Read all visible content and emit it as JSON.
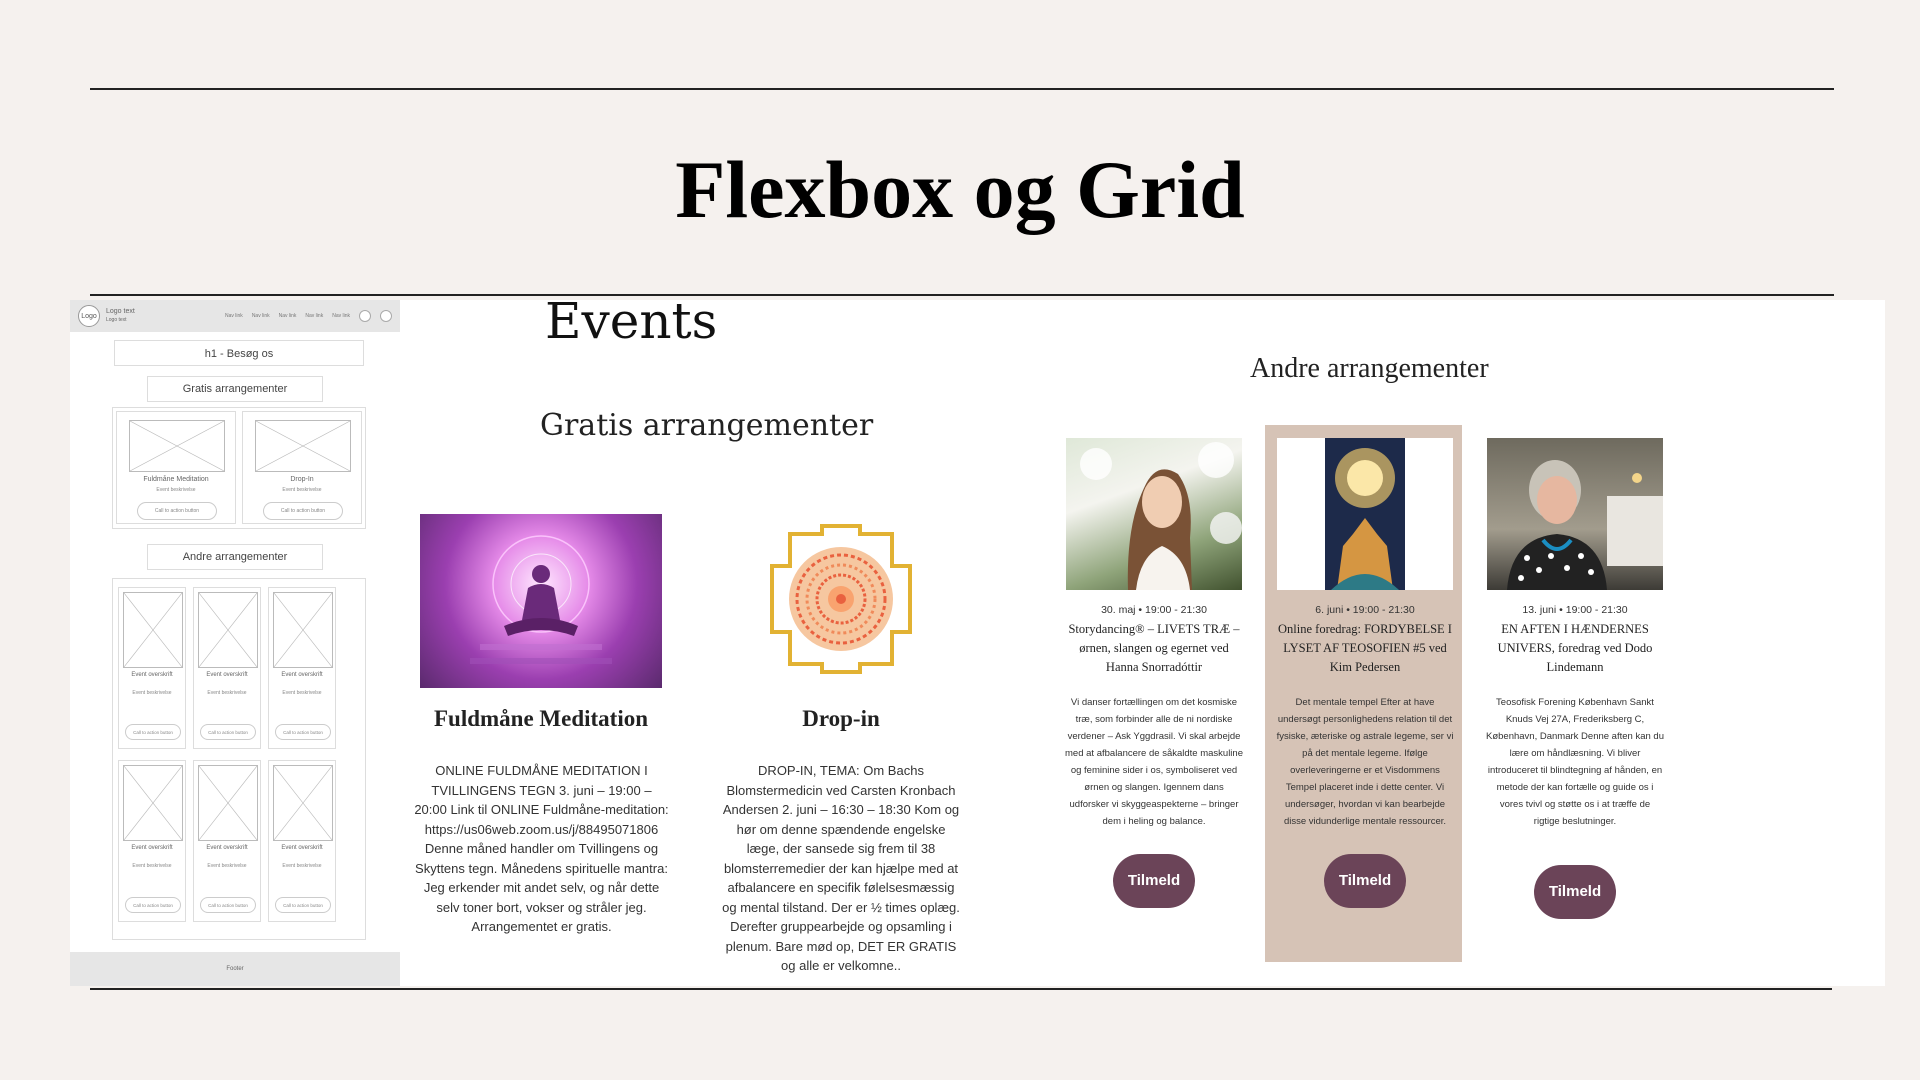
{
  "slide": {
    "title": "Flexbox og Grid"
  },
  "wireframe": {
    "logo": "Logo",
    "logo_text": "Logo text",
    "logo_subtext": "Logo text",
    "nav": [
      "Nav link",
      "Nav link",
      "Nav link",
      "Nav link",
      "Nav link"
    ],
    "search_icon": "search-icon",
    "cart_icon": "cart-icon",
    "h1": "h1 - Besøg os",
    "gratis_label": "Gratis arrangementer",
    "andre_label": "Andre arrangementer",
    "gratis_cards": [
      {
        "title": "Fuldmåne Meditation",
        "sub": "Event beskrivelse",
        "button": "Call to action button"
      },
      {
        "title": "Drop-In",
        "sub": "Event beskrivelse",
        "button": "Call to action button"
      }
    ],
    "andre_cards": [
      {
        "title": "Event overskrift",
        "sub": "Event beskrivelse",
        "button": "Call to action button"
      },
      {
        "title": "Event overskrift",
        "sub": "Event beskrivelse",
        "button": "Call to action button"
      },
      {
        "title": "Event overskrift",
        "sub": "Event beskrivelse",
        "button": "Call to action button"
      },
      {
        "title": "Event overskrift",
        "sub": "Event beskrivelse",
        "button": "Call to action button"
      },
      {
        "title": "Event overskrift",
        "sub": "Event beskrivelse",
        "button": "Call to action button"
      },
      {
        "title": "Event overskrift",
        "sub": "Event beskrivelse",
        "button": "Call to action button"
      }
    ],
    "footer": "Footer"
  },
  "events": {
    "heading": "Events",
    "gratis_heading": "Gratis arrangementer",
    "andre_heading": "Andre arrangementer",
    "gratis": [
      {
        "title": "Fuldmåne Meditation",
        "description": "ONLINE FULDMÅNE MEDITATION I TVILLINGENS TEGN 3. juni – 19:00 – 20:00 Link til ONLINE Fuldmåne-meditation: https://us06web.zoom.us/j/88495071806 Denne måned handler om Tvillingens og Skyttens tegn. Månedens spirituelle mantra: Jeg erkender mit andet selv, og når dette selv toner bort, vokser og stråler jeg. Arrangementet er gratis."
      },
      {
        "title": "Drop-in",
        "description": "DROP-IN, TEMA: Om Bachs Blomstermedicin ved Carsten Kronbach Andersen 2. juni – 16:30 – 18:30 Kom og hør om denne spændende engelske læge, der sansede sig frem til 38 blomsterremedier der kan hjælpe med at afbalancere en specifik følelsesmæssig og mental tilstand. Der er ½ times oplæg. Derefter gruppearbejde og opsamling i plenum. Bare mød op, DET ER GRATIS og alle er velkomne.."
      }
    ],
    "andre": [
      {
        "date": "30. maj • 19:00 - 21:30",
        "title": "Storydancing® – LIVETS TRÆ – ørnen, slangen og egernet ved Hanna Snorradóttir",
        "description": "Vi danser fortællingen om det kosmiske træ, som forbinder alle de ni nordiske verdener – Ask Yggdrasil. Vi skal arbejde med at afbalancere de såkaldte maskuline og feminine sider i os, symboliseret ved ørnen og slangen. Igennem dans udforsker vi skyggeaspekterne – bringer dem i heling og balance.",
        "button": "Tilmeld"
      },
      {
        "date": "6. juni • 19:00 - 21:30",
        "title": "Online foredrag: FORDYBELSE I LYSET AF TEOSOFIEN #5 ved Kim Pedersen",
        "description": "Det mentale tempel Efter at have undersøgt personlighedens relation til det fysiske, æteriske og astrale legeme, ser vi på det mentale legeme. Ifølge overleveringerne er et Visdommens Tempel placeret inde i dette center. Vi undersøger, hvordan vi kan bearbejde disse vidunderlige mentale ressourcer.",
        "button": "Tilmeld"
      },
      {
        "date": "13. juni • 19:00 - 21:30",
        "title": "EN AFTEN I HÆNDERNES UNIVERS, foredrag ved Dodo Lindemann",
        "description": "Teosofisk Forening København Sankt Knuds Vej 27A, Frederiksberg C, København, Danmark Denne aften kan du lære om håndlæsning. Vi bliver introduceret til blindtegning af hånden, en metode der kan fortælle og guide os i vores tvivl og støtte os i at træffe de rigtige beslutninger.",
        "button": "Tilmeld"
      }
    ]
  },
  "colors": {
    "button": "#6b4458",
    "highlight_card": "#d6c3b6",
    "slide_bg": "#f5f1ee"
  }
}
